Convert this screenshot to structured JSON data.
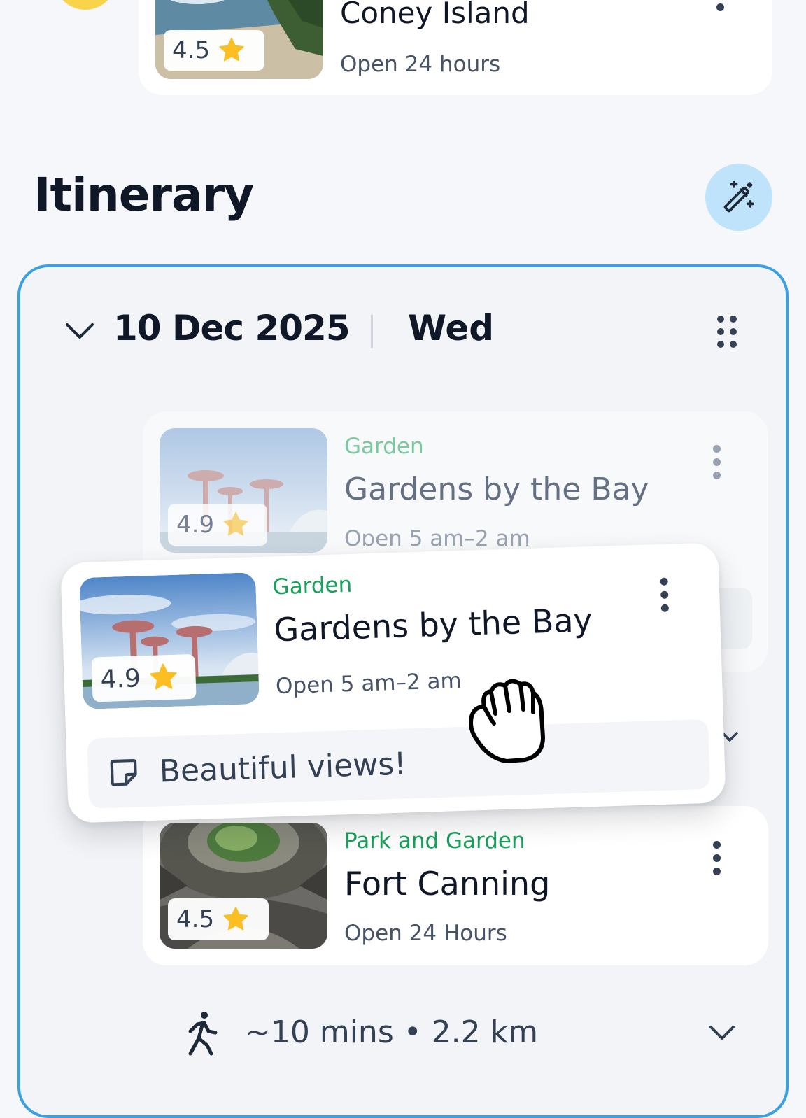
{
  "top_place": {
    "name": "Coney Island",
    "hours": "Open 24 hours",
    "rating": "4.5"
  },
  "itinerary": {
    "heading": "Itinerary",
    "magic_icon": "magic-wand-icon"
  },
  "day": {
    "date": "10 Dec 2025",
    "weekday": "Wed",
    "expand_icon": "chevron-down-icon",
    "drag_icon": "drag-handle-icon"
  },
  "places": [
    {
      "category": "Garden",
      "name": "Gardens by the Bay",
      "hours": "Open 5 am–2 am",
      "rating": "4.9",
      "note": "Beautiful views!"
    },
    {
      "category": "Park and Garden",
      "name": "Fort Canning",
      "hours": "Open 24 Hours",
      "rating": "4.5"
    }
  ],
  "travel": {
    "mode_icon": "walking-icon",
    "summary": "~10 mins • 2.2 km"
  },
  "colors": {
    "accent_blue": "#3aa0e4",
    "category_green": "#17a15b",
    "star_yellow": "#fbbf24",
    "magic_button_bg": "#bfe3fb"
  }
}
